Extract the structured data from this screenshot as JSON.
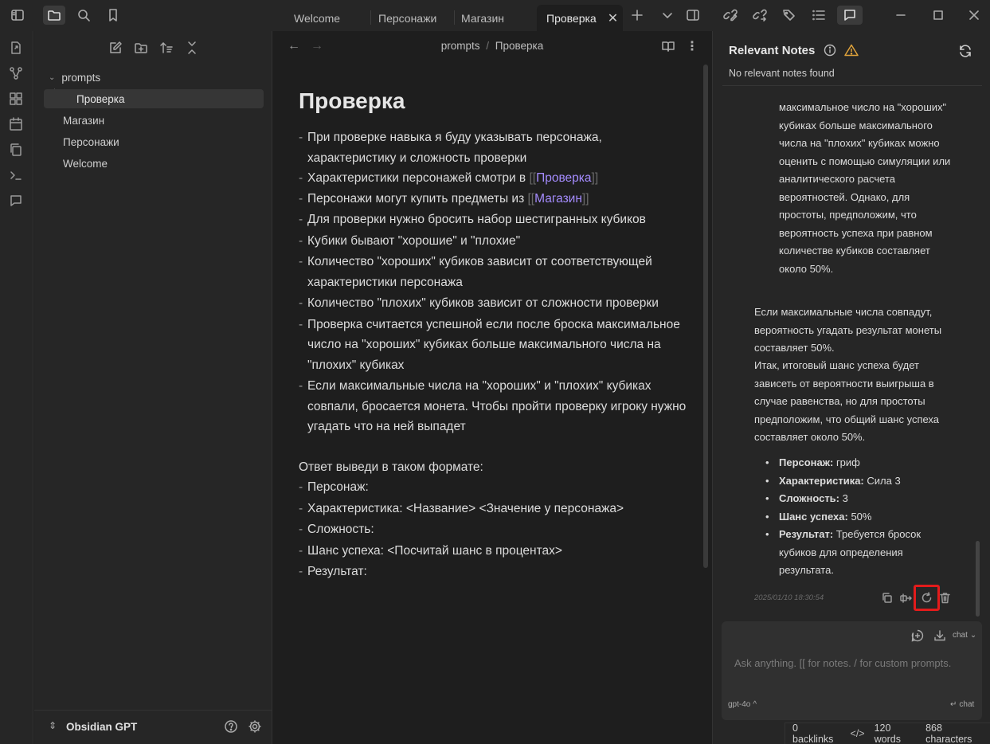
{
  "tabs": [
    {
      "label": "Welcome",
      "active": false
    },
    {
      "label": "Персонажи",
      "active": false
    },
    {
      "label": "Магазин",
      "active": false
    },
    {
      "label": "Проверка",
      "active": true
    }
  ],
  "explorer": {
    "items": [
      {
        "label": "prompts",
        "type": "folder"
      },
      {
        "label": "Проверка",
        "type": "file",
        "selected": true
      },
      {
        "label": "Магазин",
        "type": "file"
      },
      {
        "label": "Персонажи",
        "type": "file"
      },
      {
        "label": "Welcome",
        "type": "file"
      }
    ],
    "vault_name": "Obsidian GPT"
  },
  "editor": {
    "breadcrumb_folder": "prompts",
    "breadcrumb_sep": "/",
    "breadcrumb_file": "Проверка",
    "title": "Проверка",
    "lines": {
      "l1": "При проверке навыка я буду указывать персонажа, характеристику и сложность проверки",
      "l2_pre": "Характеристики персонажей смотри в ",
      "l2_link": "Проверка",
      "l3_pre": "Персонажи могут купить предметы из ",
      "l3_link": "Магазин",
      "l4": "Для проверки нужно бросить набор шестигранных кубиков",
      "l5": "Кубики бывают \"хорошие\" и \"плохие\"",
      "l6": "Количество \"хороших\" кубиков зависит от соответствующей характеристики персонажа",
      "l7": "Количество \"плохих\" кубиков зависит от сложности проверки",
      "l8": "Проверка считается успешной если после броска максимальное число на \"хороших\" кубиках больше максимального числа на \"плохих\" кубиках",
      "l9": "Если максимальные числа на \"хороших\" и \"плохих\" кубиках совпали, бросается монета. Чтобы пройти проверку игроку нужно угадать что на ней выпадет",
      "format_intro": "Ответ выведи в таком формате:",
      "f1": "Персонаж:",
      "f2": "Характеристика: <Название> <Значение у персонажа>",
      "f3": "Сложность:",
      "f4": "Шанс успеха: <Посчитай шанс в процентах>",
      "f5": "Результат:"
    },
    "link_open": "[[",
    "link_close": "]]"
  },
  "right_panel": {
    "title": "Relevant Notes",
    "subtitle": "No relevant notes found",
    "chat": {
      "p1": "максимальное число на \"хороших\" кубиках больше максимального числа на \"плохих\" кубиках можно оценить с помощью симуляции или аналитического расчета вероятностей. Однако, для простоты, предположим, что вероятность успеха при равном количестве кубиков составляет около 50%.",
      "p2": "Если максимальные числа совпадут, вероятность угадать результат монеты составляет 50%.",
      "p3": "Итак, итоговый шанс успеха будет зависеть от вероятности выигрыша в случае равенства, но для простоты предположим, что общий шанс успеха составляет около 50%.",
      "results": [
        {
          "key": "Персонаж:",
          "value": " гриф"
        },
        {
          "key": "Характеристика:",
          "value": " Сила 3"
        },
        {
          "key": "Сложность:",
          "value": " 3"
        },
        {
          "key": "Шанс успеха:",
          "value": " 50%"
        },
        {
          "key": "Результат:",
          "value": " Требуется бросок кубиков для определения результата."
        }
      ],
      "timestamp": "2025/01/10 18:30:54"
    },
    "composer": {
      "placeholder": "Ask anything. [[ for notes. / for custom prompts.",
      "mode": "chat",
      "model": "gpt-4o",
      "send_label": "chat"
    }
  },
  "status_bar": {
    "backlinks": "0 backlinks",
    "words": "120 words",
    "characters": "868 characters"
  },
  "colors": {
    "accent": "#a58cff",
    "highlight_box": "#e31b1b",
    "warning": "#e0a33b"
  }
}
